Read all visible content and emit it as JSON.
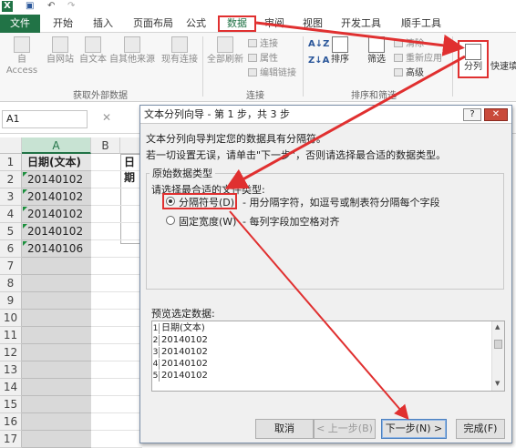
{
  "qat": {
    "app_icon": "excel-icon",
    "save_icon": "save-icon",
    "undo_icon": "undo-icon",
    "redo_icon": "redo-icon"
  },
  "tabs": [
    "文件",
    "开始",
    "插入",
    "页面布局",
    "公式",
    "数据",
    "审阅",
    "视图",
    "开发工具",
    "顺手工具"
  ],
  "ribbon": {
    "external": {
      "buttons": [
        "自 Access",
        "自网站",
        "自文本",
        "自其他来源",
        "现有连接"
      ],
      "label": "获取外部数据"
    },
    "connections": {
      "refresh_all": "全部刷新",
      "items": [
        "连接",
        "属性",
        "编辑链接"
      ],
      "label": "连接"
    },
    "sortfilter": {
      "sort": "排序",
      "filter": "筛选",
      "items": [
        "清除",
        "重新应用",
        "高级"
      ],
      "label": "排序和筛选"
    },
    "split": "分列",
    "flash": "快速填"
  },
  "formula_bar": {
    "name_box": "A1",
    "cancel": "✕"
  },
  "grid": {
    "col_a": "A",
    "col_b": "B",
    "rows": [
      "1",
      "2",
      "3",
      "4",
      "5",
      "6",
      "7",
      "8",
      "9",
      "10",
      "11",
      "12",
      "13",
      "14",
      "15",
      "16",
      "17"
    ],
    "cells_a": [
      "日期(文本)",
      "20140102",
      "20140102",
      "20140102",
      "20140102",
      "20140106"
    ],
    "cell_b1": "日期"
  },
  "dialog": {
    "title": "文本分列向导 - 第 1 步，共 3 步",
    "help": "?",
    "close": "✕",
    "intro": "文本分列向导判定您的数据具有分隔符。",
    "hint": "若一切设置无误，请单击\"下一步\"，否则请选择最合适的数据类型。",
    "group_label": "原始数据类型",
    "choose_label": "请选择最合适的文件类型:",
    "opt_delimited": "分隔符号(D)",
    "opt_delimited_desc": "- 用分隔字符，如逗号或制表符分隔每个字段",
    "opt_fixed": "固定宽度(W)",
    "opt_fixed_desc": "- 每列字段加空格对齐",
    "preview_label": "预览选定数据:",
    "preview_rows": [
      {
        "n": "1",
        "t": "日期(文本)"
      },
      {
        "n": "2",
        "t": "20140102"
      },
      {
        "n": "3",
        "t": "20140102"
      },
      {
        "n": "4",
        "t": "20140102"
      },
      {
        "n": "5",
        "t": "20140102"
      }
    ],
    "buttons": {
      "cancel": "取消",
      "back": "< 上一步(B)",
      "next": "下一步(N) >",
      "finish": "完成(F)"
    }
  },
  "colors": {
    "excel_green": "#217346",
    "highlight_red": "#e03030"
  }
}
